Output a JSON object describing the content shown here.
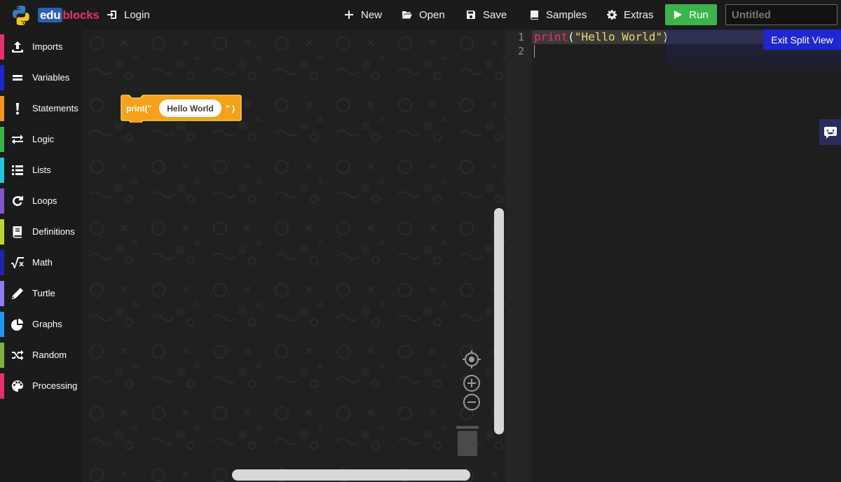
{
  "app": {
    "brand_edu": "edu",
    "brand_blocks": "blocks"
  },
  "toolbar": {
    "login_label": "Login",
    "new_label": "New",
    "open_label": "Open",
    "save_label": "Save",
    "samples_label": "Samples",
    "extras_label": "Extras",
    "run_label": "Run",
    "title_placeholder": "Untitled"
  },
  "sidebar": {
    "items": [
      {
        "label": "Imports",
        "color": "#e6306f",
        "icon": "upload-icon"
      },
      {
        "label": "Variables",
        "color": "#1f25d0",
        "icon": "equals-icon"
      },
      {
        "label": "Statements",
        "color": "#f5951f",
        "icon": "exclamation-icon"
      },
      {
        "label": "Logic",
        "color": "#39b54a",
        "icon": "arrows-exchange-icon"
      },
      {
        "label": "Lists",
        "color": "#26c6da",
        "icon": "list-icon"
      },
      {
        "label": "Loops",
        "color": "#7e57c2",
        "icon": "redo-icon"
      },
      {
        "label": "Definitions",
        "color": "#b9d432",
        "icon": "book-icon"
      },
      {
        "label": "Math",
        "color": "#1f25a8",
        "icon": "square-root-icon"
      },
      {
        "label": "Turtle",
        "color": "#8e7cf0",
        "icon": "pencil-icon"
      },
      {
        "label": "Graphs",
        "color": "#2196f3",
        "icon": "pie-chart-icon"
      },
      {
        "label": "Random",
        "color": "#7cb342",
        "icon": "shuffle-icon"
      },
      {
        "label": "Processing",
        "color": "#e6306f",
        "icon": "palette-icon"
      }
    ]
  },
  "workspace": {
    "block": {
      "prefix": "print(\"",
      "value": "Hello World",
      "suffix": "\" )",
      "color": "#f5a21a"
    }
  },
  "editor": {
    "line_numbers": [
      "1",
      "2"
    ],
    "code": {
      "keyword": "print",
      "open": "(",
      "string": "\"Hello World\"",
      "close": ")"
    },
    "exit_split_label": "Exit Split View"
  }
}
